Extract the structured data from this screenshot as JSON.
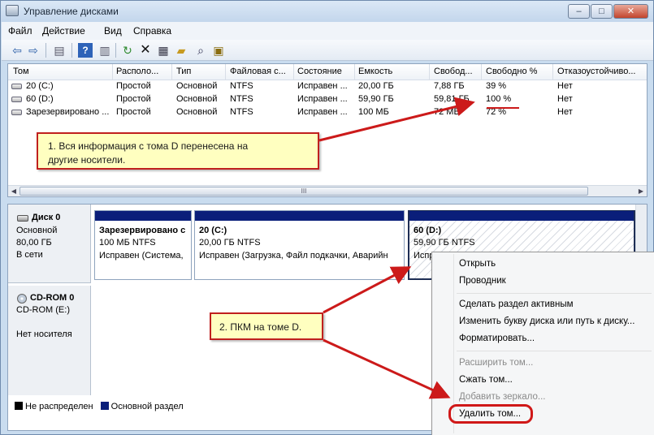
{
  "window": {
    "title": "Управление дисками",
    "buttons": [
      "–",
      "□",
      "✕"
    ]
  },
  "menu": [
    "Файл",
    "Действие",
    "Вид",
    "Справка"
  ],
  "toolbar": {
    "icons": [
      "back-icon",
      "forward-icon",
      "console-tree-icon",
      "help-icon",
      "show-pane-icon",
      "refresh-icon",
      "delete-icon",
      "properties-icon",
      "open-icon",
      "search-icon",
      "settings-icon"
    ]
  },
  "volumes": {
    "columns": [
      "Том",
      "Располо...",
      "Тип",
      "Файловая с...",
      "Состояние",
      "Емкость",
      "Свобод...",
      "Свободно %",
      "Отказоустойчиво..."
    ],
    "rows": [
      [
        "20 (C:)",
        "Простой",
        "Основной",
        "NTFS",
        "Исправен ...",
        "20,00 ГБ",
        "7,88 ГБ",
        "39 %",
        "Нет"
      ],
      [
        "60 (D:)",
        "Простой",
        "Основной",
        "NTFS",
        "Исправен ...",
        "59,90 ГБ",
        "59,81 ГБ",
        "100 %",
        "Нет"
      ],
      [
        "Зарезервировано ...",
        "Простой",
        "Основной",
        "NTFS",
        "Исправен ...",
        "100 МБ",
        "72 МБ",
        "72 %",
        "Нет"
      ]
    ],
    "scroll_mark": "III"
  },
  "disks": {
    "disk0": {
      "name": "Диск 0",
      "type": "Основной",
      "size": "80,00 ГБ",
      "status": "В сети",
      "partitions": [
        {
          "title": "Зарезервировано с",
          "line1": "100 МБ NTFS",
          "line2": "Исправен (Система,"
        },
        {
          "title": "20  (C:)",
          "line1": "20,00 ГБ NTFS",
          "line2": "Исправен (Загрузка, Файл подкачки, Аварийн"
        },
        {
          "title": "60  (D:)",
          "line1": "59,90 ГБ NTFS",
          "line2": "Испр"
        }
      ]
    },
    "cdrom0": {
      "name": "CD-ROM 0",
      "drive": "CD-ROM (E:)",
      "status": "Нет носителя"
    }
  },
  "legend": [
    {
      "label": "Не распределен",
      "color": "#000000"
    },
    {
      "label": "Основной раздел",
      "color": "#0a1e7a"
    }
  ],
  "context_menu": {
    "items": [
      {
        "label": "Открыть",
        "enabled": true
      },
      {
        "label": "Проводник",
        "enabled": true
      },
      {
        "label": "Сделать раздел активным",
        "enabled": true
      },
      {
        "label": "Изменить букву диска или путь к диску...",
        "enabled": true
      },
      {
        "label": "Форматировать...",
        "enabled": true
      },
      {
        "label": "Расширить том...",
        "enabled": false
      },
      {
        "label": "Сжать том...",
        "enabled": true
      },
      {
        "label": "Добавить зеркало...",
        "enabled": false
      },
      {
        "label": "Удалить том...",
        "enabled": true
      }
    ]
  },
  "callouts": {
    "step1_line1": "1. Вся информация с тома D перенесена на",
    "step1_line2": "другие носители.",
    "step2": "2. ПКМ на томе D."
  },
  "colors": {
    "annotation": "#cc1a1a",
    "callout_bg": "#ffffc0",
    "partition_bar": "#0a1e7a"
  }
}
